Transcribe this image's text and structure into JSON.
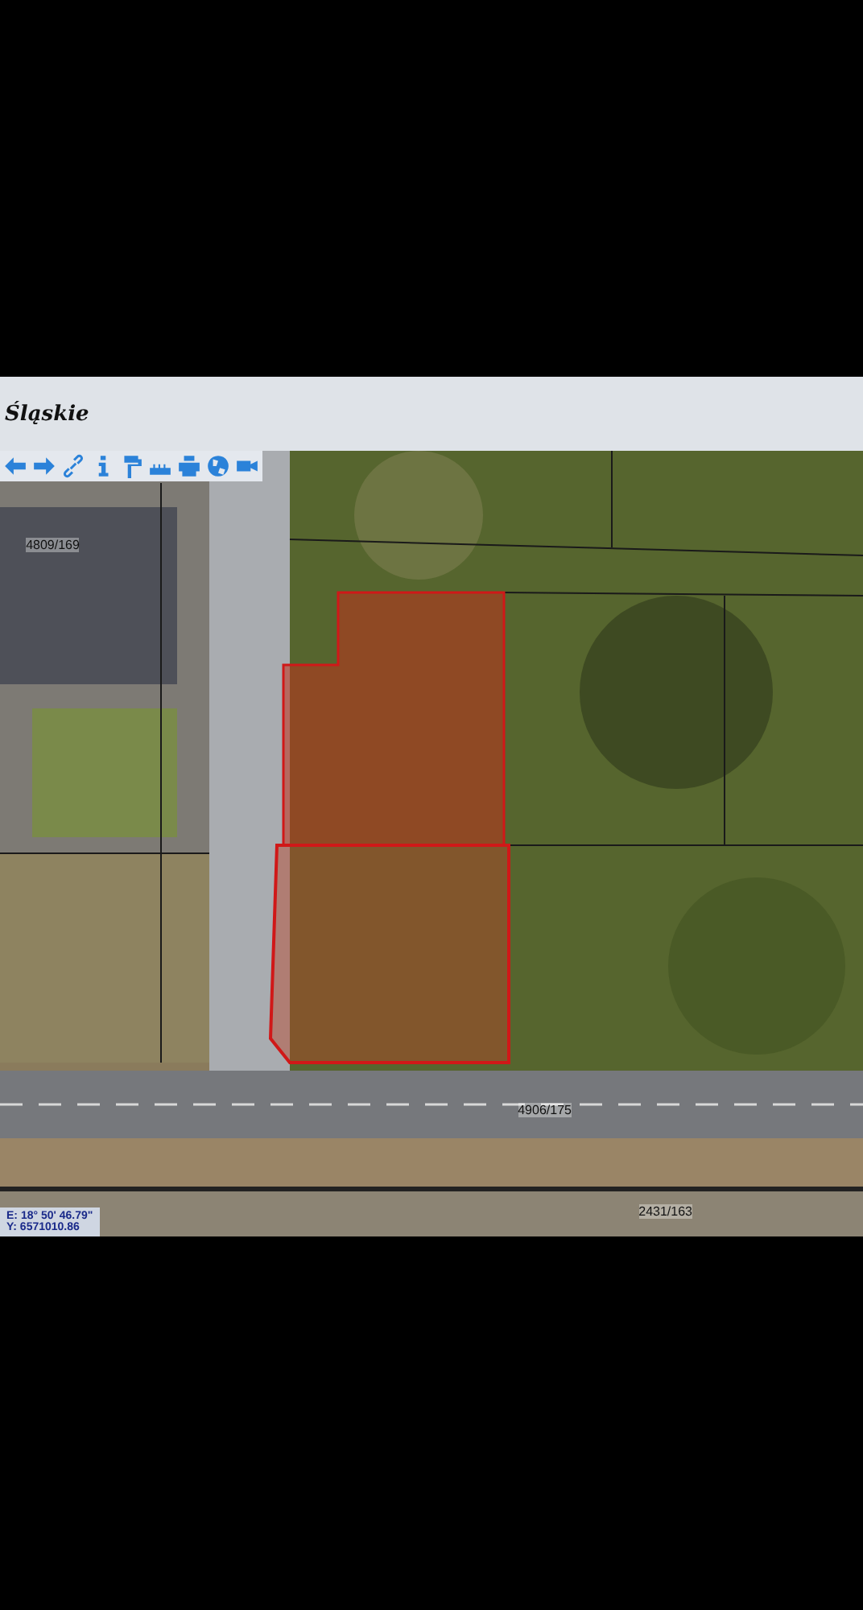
{
  "header": {
    "title": "Śląskie"
  },
  "map": {
    "parcel_labels": [
      "4809/169",
      "4906/175",
      "2431/163"
    ],
    "coordinates": {
      "e": "E: 18° 50' 46.79\"",
      "y": "Y: 6571010.86"
    }
  }
}
